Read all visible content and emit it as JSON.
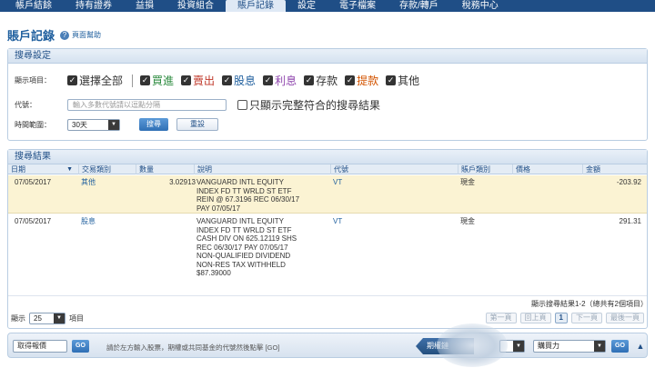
{
  "nav": {
    "items": [
      {
        "label": "帳戶結餘"
      },
      {
        "label": "持有證券"
      },
      {
        "label": "益損"
      },
      {
        "label": "投資組合"
      },
      {
        "label": "賬戶記錄"
      },
      {
        "label": "設定"
      },
      {
        "label": "電子檔案"
      },
      {
        "label": "存款/轉戶"
      },
      {
        "label": "稅務中心"
      }
    ],
    "active_index": 4
  },
  "page": {
    "title": "賬戶記錄",
    "help_link": "頁面幫助"
  },
  "search": {
    "panel_title": "搜尋設定",
    "display_label": "顯示項目：",
    "select_all": "選擇全部",
    "types": [
      {
        "label": "買進",
        "color": "#2b8a3e"
      },
      {
        "label": "賣出",
        "color": "#c0392b"
      },
      {
        "label": "股息",
        "color": "#1f5f9e"
      },
      {
        "label": "利息",
        "color": "#8e44ad"
      },
      {
        "label": "存款",
        "color": "#333333"
      },
      {
        "label": "提款",
        "color": "#d35400"
      },
      {
        "label": "其他",
        "color": "#333333"
      }
    ],
    "code_label": "代號：",
    "code_placeholder": "輸入多數代號請以逗點分隔",
    "exact_match_label": "只顯示完整符合的搜尋結果",
    "range_label": "時間範圍：",
    "range_value": "30天",
    "search_button": "搜尋",
    "reset_button": "重設"
  },
  "results": {
    "panel_title": "搜尋結果",
    "columns": {
      "date": "日期",
      "type": "交易類別",
      "qty": "數量",
      "desc": "說明",
      "symbol": "代號",
      "account_type": "賬戶類別",
      "price": "價格",
      "amount": "金額"
    },
    "rows": [
      {
        "date": "07/05/2017",
        "type": "其他",
        "qty": "3.02913",
        "desc": [
          "VANGUARD INTL EQUITY",
          "INDEX FD TT WRLD ST ETF",
          "REIN @ 67.3196 REC 06/30/17",
          "PAY 07/05/17"
        ],
        "symbol": "VT",
        "account_type": "現金",
        "price": "",
        "amount": "-203.92"
      },
      {
        "date": "07/05/2017",
        "type": "股息",
        "qty": "",
        "desc": [
          "VANGUARD INTL EQUITY",
          "INDEX FD TT WRLD ST ETF",
          "CASH DIV ON 625.12119 SHS",
          "REC 06/30/17 PAY 07/05/17",
          "NON-QUALIFIED DIVIDEND",
          "NON-RES TAX WITHHELD",
          "$87.39000"
        ],
        "symbol": "VT",
        "account_type": "現金",
        "price": "",
        "amount": "291.31"
      }
    ],
    "summary": "顯示搜尋結果1-2（總共有2個項目）",
    "per_page_label": "顯示",
    "per_page_value": "25",
    "per_page_suffix": "項目",
    "pager": {
      "first": "第一頁",
      "prev": "回上頁",
      "current": "1",
      "next": "下一頁",
      "last": "最後一頁"
    }
  },
  "quote_bar": {
    "quote_label": "取得報價",
    "go_label": "GO",
    "hint": "請於左方輸入股票，期權或共同基金的代號然後點擊 [GO]",
    "chain_label": "期權鏈",
    "buying_power_label": "購買力",
    "go2_label": "GO"
  }
}
